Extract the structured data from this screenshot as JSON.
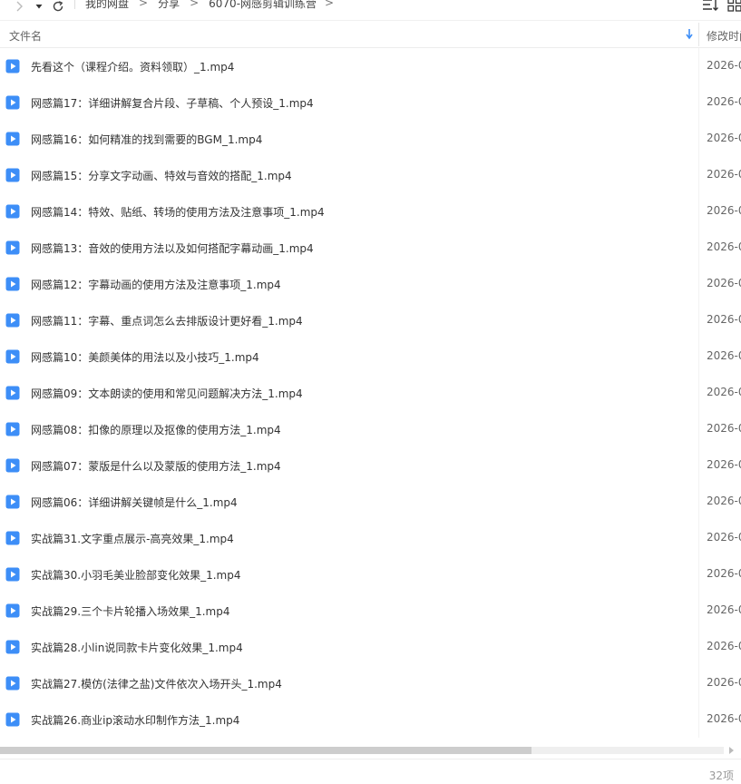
{
  "toolbar": {
    "back_icon": "chevron-right-icon",
    "dropdown_icon": "caret-down-icon",
    "refresh_icon": "refresh-icon",
    "sort_icon": "sort-list-icon",
    "view_icon": "grid-view-icon"
  },
  "breadcrumb": [
    "我的网盘",
    "分享",
    "6070-网感剪辑训练营"
  ],
  "columns": {
    "name": "文件名",
    "modified": "修改时间"
  },
  "accent_color": "#3d8ef7",
  "files": [
    {
      "name": "先看这个（课程介绍。资料领取）_1.mp4",
      "date": "2026-0"
    },
    {
      "name": "网感篇17：详细讲解复合片段、子草稿、个人预设_1.mp4",
      "date": "2026-0"
    },
    {
      "name": "网感篇16：如何精准的找到需要的BGM_1.mp4",
      "date": "2026-0"
    },
    {
      "name": "网感篇15：分享文字动画、特效与音效的搭配_1.mp4",
      "date": "2026-0"
    },
    {
      "name": "网感篇14：特效、贴纸、转场的使用方法及注意事项_1.mp4",
      "date": "2026-0"
    },
    {
      "name": "网感篇13：音效的使用方法以及如何搭配字幕动画_1.mp4",
      "date": "2026-0"
    },
    {
      "name": "网感篇12：字幕动画的使用方法及注意事项_1.mp4",
      "date": "2026-0"
    },
    {
      "name": "网感篇11：字幕、重点词怎么去排版设计更好看_1.mp4",
      "date": "2026-0"
    },
    {
      "name": "网感篇10：美颜美体的用法以及小技巧_1.mp4",
      "date": "2026-0"
    },
    {
      "name": "网感篇09：文本朗读的使用和常见问题解决方法_1.mp4",
      "date": "2026-0"
    },
    {
      "name": "网感篇08：扣像的原理以及抠像的使用方法_1.mp4",
      "date": "2026-0"
    },
    {
      "name": "网感篇07：蒙版是什么以及蒙版的使用方法_1.mp4",
      "date": "2026-0"
    },
    {
      "name": "网感篇06：详细讲解关键帧是什么_1.mp4",
      "date": "2026-0"
    },
    {
      "name": "实战篇31.文字重点展示-高亮效果_1.mp4",
      "date": "2026-0"
    },
    {
      "name": "实战篇30.小羽毛美业脸部变化效果_1.mp4",
      "date": "2026-0"
    },
    {
      "name": "实战篇29.三个卡片轮播入场效果_1.mp4",
      "date": "2026-0"
    },
    {
      "name": "实战篇28.小lin说同款卡片变化效果_1.mp4",
      "date": "2026-0"
    },
    {
      "name": "实战篇27.模仿(法律之盐)文件依次入场开头_1.mp4",
      "date": "2026-0"
    },
    {
      "name": "实战篇26.商业ip滚动水印制作方法_1.mp4",
      "date": "2026-0"
    }
  ],
  "status": {
    "count": "32项"
  }
}
